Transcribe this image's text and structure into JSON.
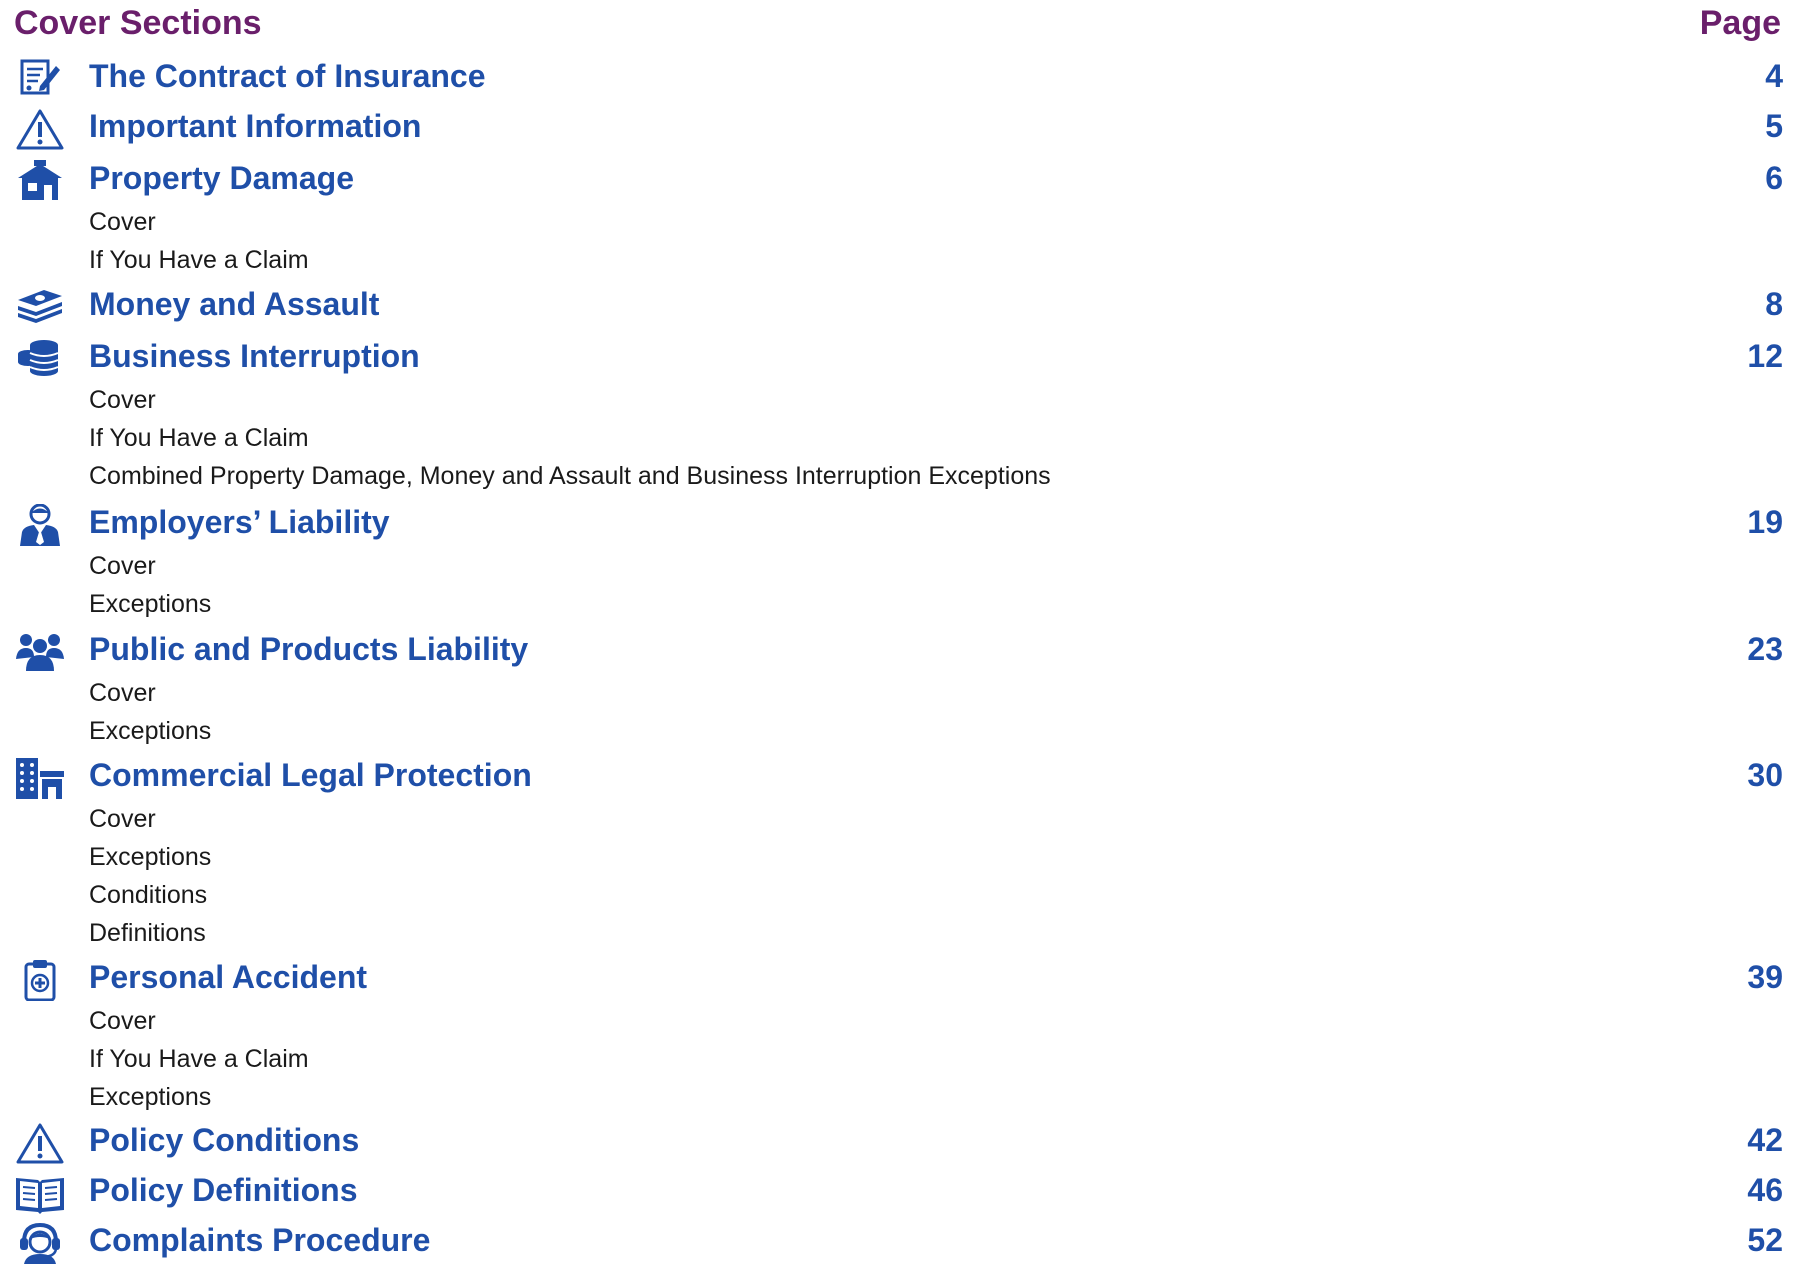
{
  "header": {
    "title": "Cover Sections",
    "page_label": "Page"
  },
  "sections": [
    {
      "icon": "contract-edit-icon",
      "title": "The Contract of Insurance",
      "page": "4",
      "subs": []
    },
    {
      "icon": "warning-icon",
      "title": "Important Information",
      "page": "5",
      "subs": []
    },
    {
      "icon": "house-icon",
      "title": "Property Damage",
      "page": "6",
      "subs": [
        "Cover",
        "If You Have a Claim"
      ]
    },
    {
      "icon": "cash-stack-icon",
      "title": "Money and Assault",
      "page": "8",
      "subs": []
    },
    {
      "icon": "coins-icon",
      "title": "Business Interruption",
      "page": "12",
      "subs": [
        "Cover",
        "If You Have a Claim",
        "Combined Property Damage, Money and Assault and Business Interruption Exceptions"
      ]
    },
    {
      "icon": "employee-icon",
      "title": "Employers’ Liability",
      "page": "19",
      "subs": [
        "Cover",
        "Exceptions"
      ]
    },
    {
      "icon": "group-icon",
      "title": "Public and Products Liability",
      "page": "23",
      "subs": [
        "Cover",
        "Exceptions"
      ]
    },
    {
      "icon": "buildings-icon",
      "title": "Commercial Legal Protection",
      "page": "30",
      "subs": [
        "Cover",
        "Exceptions",
        "Conditions",
        "Definitions"
      ]
    },
    {
      "icon": "medical-clipboard-icon",
      "title": "Personal Accident",
      "page": "39",
      "subs": [
        "Cover",
        "If You Have a Claim",
        "Exceptions"
      ]
    },
    {
      "icon": "warning-icon",
      "title": "Policy Conditions",
      "page": "42",
      "subs": []
    },
    {
      "icon": "open-book-icon",
      "title": "Policy Definitions",
      "page": "46",
      "subs": []
    },
    {
      "icon": "headset-agent-icon",
      "title": "Complaints Procedure",
      "page": "52",
      "subs": []
    }
  ],
  "colors": {
    "heading": "#6a1f6b",
    "link": "#1f4fa8",
    "text": "#1a1a1a"
  }
}
